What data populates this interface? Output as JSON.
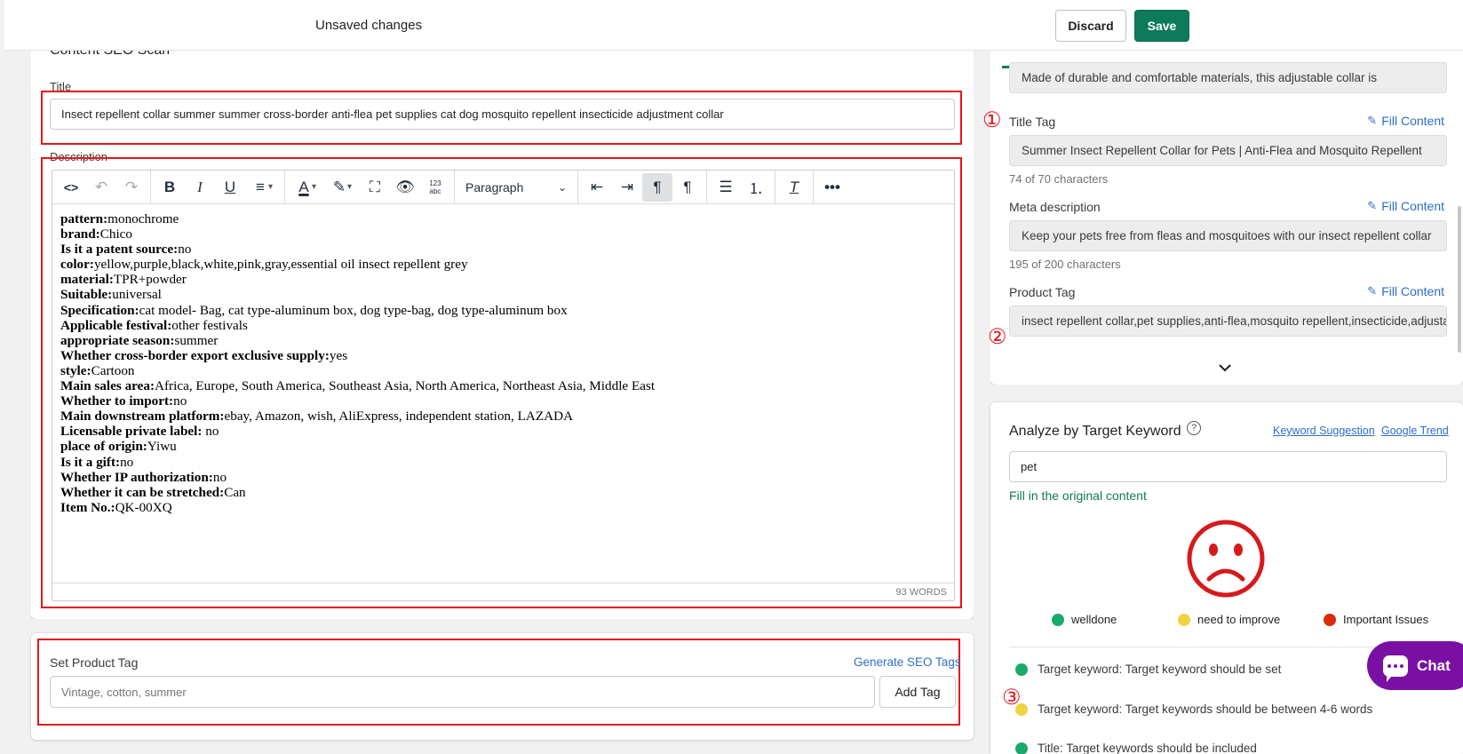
{
  "header": {
    "status": "Unsaved changes",
    "discard_label": "Discard",
    "save_label": "Save"
  },
  "content_scan": {
    "heading": "Content SEO Scan",
    "title_label": "Title",
    "title_value": "Insect repellent collar summer summer cross-border anti-flea pet supplies cat dog mosquito repellent insecticide adjustment collar",
    "description_label": "Description",
    "editor": {
      "block_format": "Paragraph",
      "word_count": "93 WORDS",
      "lines": [
        {
          "key": "pattern:",
          "value": "monochrome"
        },
        {
          "key": "brand:",
          "value": "Chico"
        },
        {
          "key": "Is it a patent source:",
          "value": "no"
        },
        {
          "key": "color:",
          "value": "yellow,purple,black,white,pink,gray,essential oil insect repellent grey"
        },
        {
          "key": "material:",
          "value": "TPR+powder"
        },
        {
          "key": "Suitable:",
          "value": "universal"
        },
        {
          "key": "Specification:",
          "value": "cat model- Bag, cat type-aluminum box, dog type-bag, dog type-aluminum box"
        },
        {
          "key": "Applicable festival:",
          "value": "other festivals"
        },
        {
          "key": "appropriate season:",
          "value": "summer"
        },
        {
          "key": "Whether cross-border export exclusive supply:",
          "value": "yes"
        },
        {
          "key": "style:",
          "value": "Cartoon"
        },
        {
          "key": "Main sales area:",
          "value": "Africa, Europe, South America, Southeast Asia, North America, Northeast Asia, Middle East"
        },
        {
          "key": "Whether to import:",
          "value": "no"
        },
        {
          "key": "Main downstream platform:",
          "value": "ebay, Amazon, wish, AliExpress, independent station, LAZADA"
        },
        {
          "key": "Licensable private label:",
          "value": " no"
        },
        {
          "key": "place of origin:",
          "value": "Yiwu"
        },
        {
          "key": "Is it a gift:",
          "value": "no"
        },
        {
          "key": "Whether IP authorization:",
          "value": "no"
        },
        {
          "key": "Whether it can be stretched:",
          "value": "Can"
        },
        {
          "key": "Item No.:",
          "value": "QK-00XQ"
        }
      ]
    }
  },
  "product_tag_card": {
    "label": "Set Product Tag",
    "generate_link": "Generate SEO Tags",
    "input_placeholder": "Vintage, cotton, summer",
    "add_button": "Add Tag"
  },
  "seo_fields": {
    "summary_text": "Made of durable and comfortable materials, this adjustable collar is",
    "fill_label": "Fill Content",
    "title_tag": {
      "label": "Title Tag",
      "value": "Summer Insect Repellent Collar for Pets | Anti-Flea and Mosquito Repellent",
      "count": "74 of 70 characters"
    },
    "meta_description": {
      "label": "Meta description",
      "value": "Keep your pets free from fleas and mosquitoes with our insect repellent collar",
      "count": "195 of 200 characters"
    },
    "product_tag": {
      "label": "Product Tag",
      "value": "insect repellent collar,pet supplies,anti-flea,mosquito repellent,insecticide,adjustable collar"
    }
  },
  "markers": {
    "one": "①",
    "two": "②",
    "three": "③"
  },
  "analyze": {
    "title": "Analyze by Target Keyword",
    "help_glyph": "?",
    "keyword_suggestion": "Keyword Suggestion",
    "google_trend": "Google Trend",
    "keyword_value": "pet",
    "fill_original": "Fill in the original content",
    "legend": [
      {
        "label": "welldone",
        "color": "#1aaa6b"
      },
      {
        "label": "need to improve",
        "color": "#f0d341"
      },
      {
        "label": "Important Issues",
        "color": "#d82c0d"
      }
    ],
    "checks": [
      {
        "text": "Target keyword: Target keyword should be set",
        "color": "#1aaa6b"
      },
      {
        "text": "Target keyword: Target keywords should be between 4-6 words",
        "color": "#f0d341"
      },
      {
        "text": "Title: Target keywords should be included",
        "color": "#1aaa6b"
      }
    ]
  },
  "chat": {
    "label": "Chat"
  },
  "colors": {
    "accent": "#0e7a5c",
    "link": "#2c6ecb",
    "annotation_red": "#e5161d",
    "chat_purple": "#7a10a3",
    "sad_face_red": "#d7191c"
  }
}
